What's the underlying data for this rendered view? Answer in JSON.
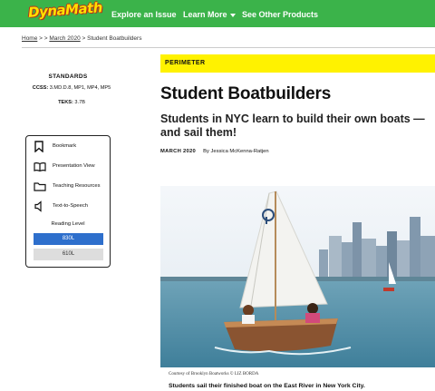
{
  "brand": {
    "logo_text": "DynaMath"
  },
  "nav": {
    "explore": "Explore an Issue",
    "learn_more": "Learn More",
    "other_products": "See Other Products"
  },
  "breadcrumb": {
    "home": "Home",
    "sep1": " > > ",
    "issue": "March 2020",
    "sep2": " > ",
    "current": "Student Boatbuilders"
  },
  "standards": {
    "title": "STANDARDS",
    "ccss_label": "CCSS:",
    "ccss_value": " 3.MD.D.8, MP1, MP4, MP5",
    "teks_label": "TEKS:",
    "teks_value": " 3.7B"
  },
  "tools": {
    "bookmark": "Bookmark",
    "presentation": "Presentation View",
    "resources": "Teaching Resources",
    "tts": "Text-to-Speech",
    "reading_level_label": "Reading Level",
    "levels": [
      "830L",
      "610L"
    ]
  },
  "article": {
    "tag": "PERIMETER",
    "headline": "Student Boatbuilders",
    "dek": "Students in NYC learn to build their own boats —and sail them!",
    "date": "MARCH 2020",
    "author": "By Jessica McKenna-Ratjen",
    "photo_credit": "Courtesy of Brooklyn Boatworks © LIZ BORDA",
    "caption": "Students sail their finished boat on the East River in New York City."
  },
  "colors": {
    "nav_green": "#3bb34a",
    "tag_yellow": "#fff200",
    "level_active": "#2e6fcc"
  }
}
